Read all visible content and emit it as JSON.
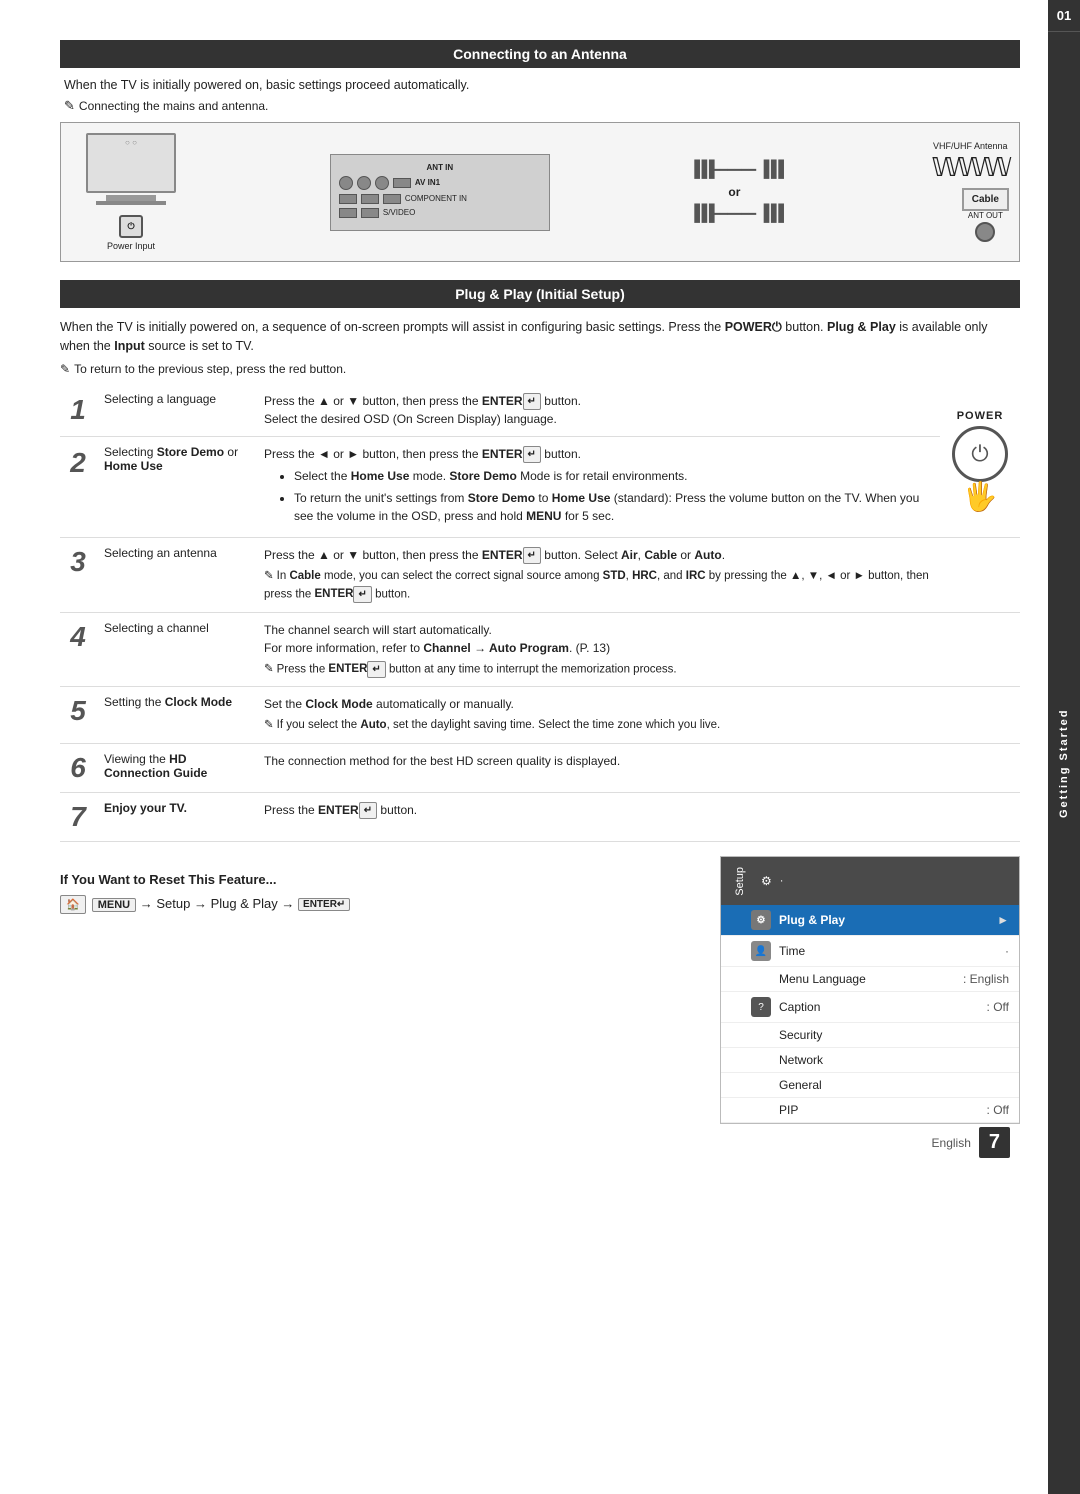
{
  "page": {
    "sidebar": {
      "number": "01",
      "text": "Getting Started"
    },
    "footer": {
      "lang": "English",
      "page_num": "7"
    }
  },
  "antenna_section": {
    "header": "Connecting to an Antenna",
    "intro": "When the TV is initially powered on, basic settings proceed automatically.",
    "note": "Connecting the mains and antenna.",
    "diagram": {
      "vhf_label": "VHF/UHF Antenna",
      "power_label": "Power Input",
      "or_text": "or",
      "cable_label": "Cable",
      "ant_in_label": "ANT IN",
      "ant_out_label": "ANT OUT"
    }
  },
  "plug_play_section": {
    "header": "Plug & Play (Initial Setup)",
    "intro": "When the TV is initially powered on, a sequence of on-screen prompts will assist in configuring basic settings. Press the POWER button. Plug & Play is available only when the Input source is set to TV.",
    "note": "To return to the previous step, press the red button.",
    "steps": [
      {
        "num": "1",
        "name": "Selecting a language",
        "desc": "Press the ▲ or ▼ button, then press the ENTER button.\nSelect the desired OSD (On Screen Display) language."
      },
      {
        "num": "2",
        "name": "Selecting Store Demo or Home Use",
        "desc_main": "Press the ◄ or ► button, then press the ENTER button.",
        "desc_bullets": [
          "Select the Home Use mode. Store Demo Mode is for retail environments.",
          "To return the unit's settings from Store Demo to Home Use (standard): Press the volume button on the TV. When you see the volume in the OSD, press and hold MENU for 5 sec."
        ]
      },
      {
        "num": "3",
        "name": "Selecting an antenna",
        "desc": "Press the ▲ or ▼ button, then press the ENTER button. Select Air, Cable or Auto.",
        "note": "In Cable mode, you can select the correct signal source among STD, HRC, and IRC by pressing the ▲, ▼, ◄ or ► button, then press the ENTER button."
      },
      {
        "num": "4",
        "name": "Selecting a channel",
        "desc": "The channel search will start automatically.\nFor more information, refer to Channel → Auto Program. (P. 13)",
        "note": "Press the ENTER button at any time to interrupt the memorization process."
      },
      {
        "num": "5",
        "name": "Setting the Clock Mode",
        "desc": "Set the Clock Mode automatically or manually.",
        "note": "If you select the Auto, set the daylight saving time. Select the time zone which you live."
      },
      {
        "num": "6",
        "name": "Viewing the HD Connection Guide",
        "desc": "The connection method for the best HD screen quality is displayed."
      },
      {
        "num": "7",
        "name": "Enjoy your TV.",
        "desc": "Press the ENTER button."
      }
    ]
  },
  "reset_section": {
    "title": "If You Want to Reset This Feature...",
    "command": "MENU → Setup → Plug & Play → ENTER"
  },
  "setup_menu": {
    "header_icon": "⚙",
    "header_label": "Setup",
    "items": [
      {
        "icon": "gear",
        "name": "Plug & Play",
        "value": "",
        "active": true
      },
      {
        "icon": "person",
        "name": "Time",
        "value": "·",
        "active": false
      },
      {
        "icon": "",
        "name": "Menu Language",
        "value": ": English",
        "active": false
      },
      {
        "icon": "question",
        "name": "Caption",
        "value": ": Off",
        "active": false
      },
      {
        "icon": "",
        "name": "Security",
        "value": "",
        "active": false
      },
      {
        "icon": "",
        "name": "Network",
        "value": "",
        "active": false
      },
      {
        "icon": "",
        "name": "General",
        "value": "",
        "active": false
      },
      {
        "icon": "",
        "name": "PIP",
        "value": ": Off",
        "active": false
      }
    ]
  }
}
